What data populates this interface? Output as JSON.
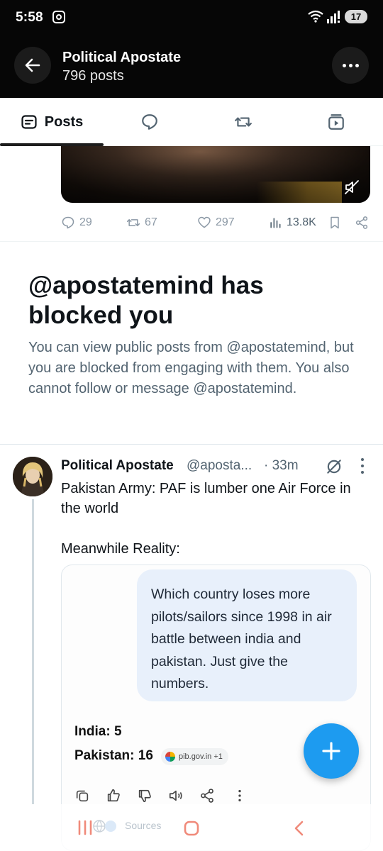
{
  "status_bar": {
    "time": "5:58",
    "battery": "17"
  },
  "header": {
    "title": "Political Apostate",
    "subtitle": "796 posts"
  },
  "tabs": [
    {
      "label": "Posts",
      "icon": "posts-icon",
      "active": true
    },
    {
      "icon": "replies-icon"
    },
    {
      "icon": "reposts-icon"
    },
    {
      "icon": "media-icon"
    }
  ],
  "first_post": {
    "replies": "29",
    "reposts": "67",
    "likes": "297",
    "views": "13.8K"
  },
  "blocked": {
    "title": "@apostatemind has blocked you",
    "message": "You can view public posts from @apostatemind, but you are blocked from engaging with them. You also cannot follow or message @apostatemind."
  },
  "second_post": {
    "name": "Political Apostate",
    "handle": "@aposta...",
    "time": "· 33m",
    "text": "Pakistan Army: PAF is lumber one Air Force in the world",
    "text2": "Meanwhile Reality:",
    "card": {
      "question": "Which country loses more pilots/sailors since 1998 in air battle between india and pakistan. Just give the numbers.",
      "answer_line_1": "India: 5",
      "answer_line_2": "Pakistan: 16",
      "source_chip": "pib.gov.in +1"
    }
  },
  "nav": {
    "ghost_label": "Sources"
  },
  "colors": {
    "accent": "#1d9bf0",
    "header_bg": "#060606",
    "muted": "#536471",
    "bubble": "#e8f0fb"
  }
}
